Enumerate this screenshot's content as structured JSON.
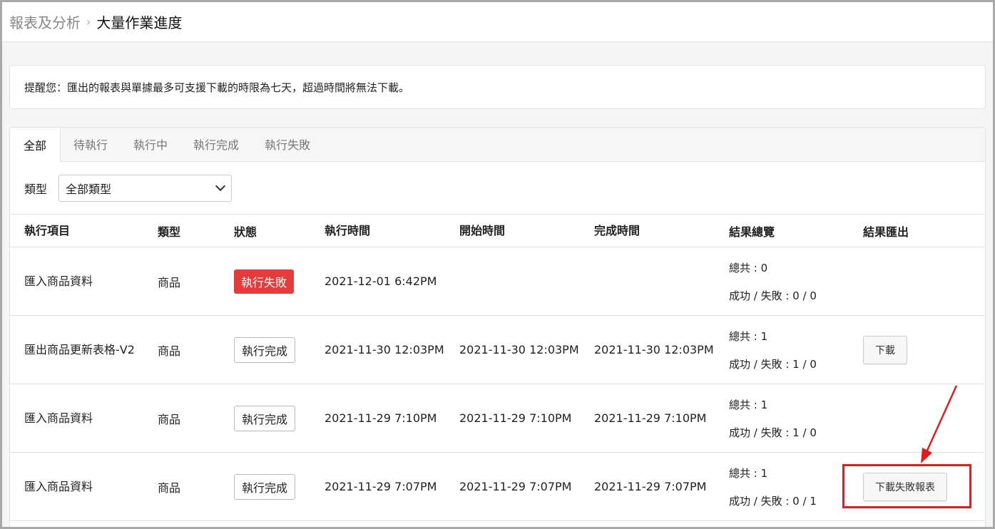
{
  "breadcrumb": {
    "parent": "報表及分析",
    "separator": "›",
    "current": "大量作業進度"
  },
  "notice": "提醒您：匯出的報表與單據最多可支援下載的時限為七天，超過時間將無法下載。",
  "tabs": [
    {
      "label": "全部",
      "active": true
    },
    {
      "label": "待執行",
      "active": false
    },
    {
      "label": "執行中",
      "active": false
    },
    {
      "label": "執行完成",
      "active": false
    },
    {
      "label": "執行失敗",
      "active": false
    }
  ],
  "filter": {
    "label": "類型",
    "selected": "全部類型"
  },
  "table": {
    "headers": [
      "執行項目",
      "類型",
      "狀態",
      "執行時間",
      "開始時間",
      "完成時間",
      "結果總覽",
      "結果匯出"
    ],
    "rows": [
      {
        "item": "匯入商品資料",
        "type": "商品",
        "status": "執行失敗",
        "exec_time": "2021-12-01 6:42PM",
        "start_time": "",
        "end_time": "",
        "total": "總共 : 0",
        "result": "成功 / 失敗 : 0 / 0",
        "export": ""
      },
      {
        "item": "匯出商品更新表格-V2",
        "type": "商品",
        "status": "執行完成",
        "exec_time": "2021-11-30 12:03PM",
        "start_time": "2021-11-30 12:03PM",
        "end_time": "2021-11-30 12:03PM",
        "total": "總共 : 1",
        "result": "成功 / 失敗 : 1 / 0",
        "export": "下載"
      },
      {
        "item": "匯入商品資料",
        "type": "商品",
        "status": "執行完成",
        "exec_time": "2021-11-29 7:10PM",
        "start_time": "2021-11-29 7:10PM",
        "end_time": "2021-11-29 7:10PM",
        "total": "總共 : 1",
        "result": "成功 / 失敗 : 1 / 0",
        "export": ""
      },
      {
        "item": "匯入商品資料",
        "type": "商品",
        "status": "執行完成",
        "exec_time": "2021-11-29 7:07PM",
        "start_time": "2021-11-29 7:07PM",
        "end_time": "2021-11-29 7:07PM",
        "total": "總共 : 1",
        "result": "成功 / 失敗 : 0 / 1",
        "export": "下載失敗報表"
      }
    ]
  },
  "colors": {
    "fail_badge": "#e53b3b",
    "annotation": "#e51a1a"
  }
}
